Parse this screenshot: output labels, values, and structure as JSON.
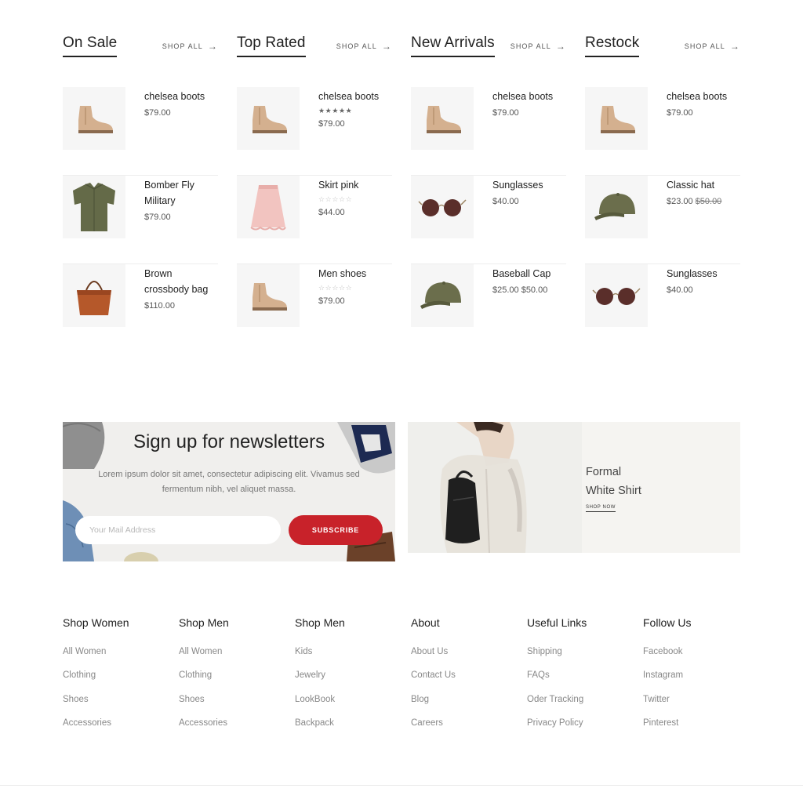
{
  "columns": [
    {
      "title": "On Sale",
      "shop_all": "SHOP ALL",
      "arrow": "→",
      "items": [
        {
          "name": "chelsea boots",
          "price": "$79.00",
          "icon": "boot-icon"
        },
        {
          "name": "Bomber Fly Military",
          "price": "$79.00",
          "icon": "shirt-icon"
        },
        {
          "name": "Brown crossbody bag",
          "price": "$110.00",
          "icon": "bag-icon"
        }
      ]
    },
    {
      "title": "Top Rated",
      "shop_all": "SHOP ALL",
      "arrow": "→",
      "items": [
        {
          "name": "chelsea boots",
          "stars": "★★★★★",
          "rating": 5,
          "price": "$79.00",
          "icon": "boot-icon"
        },
        {
          "name": "Skirt pink",
          "stars": "☆☆☆☆☆",
          "rating": 0,
          "price": "$44.00",
          "icon": "skirt-icon"
        },
        {
          "name": "Men shoes",
          "stars": "☆☆☆☆☆",
          "rating": 0,
          "price": "$79.00",
          "icon": "boot-icon"
        }
      ]
    },
    {
      "title": "New Arrivals",
      "shop_all": "SHOP ALL",
      "arrow": "→",
      "items": [
        {
          "name": "chelsea boots",
          "price": "$79.00",
          "icon": "boot-icon"
        },
        {
          "name": "Sunglasses",
          "price": "$40.00",
          "icon": "sunglasses-icon"
        },
        {
          "name": "Baseball Cap",
          "price": "$25.00 $50.00",
          "icon": "cap-icon"
        }
      ]
    },
    {
      "title": "Restock",
      "shop_all": "SHOP ALL",
      "arrow": "→",
      "items": [
        {
          "name": "chelsea boots",
          "price": "$79.00",
          "icon": "boot-icon"
        },
        {
          "name": "Classic hat",
          "price": "$23.00",
          "old_price": "$50.00",
          "icon": "cap-icon"
        },
        {
          "name": "Sunglasses",
          "price": "$40.00",
          "icon": "sunglasses-icon"
        }
      ]
    }
  ],
  "newsletter": {
    "title": "Sign up for newsletters",
    "text": "Lorem ipsum dolor sit amet, consectetur adipiscing elit. Vivamus sed fermentum nibh, vel aliquet massa.",
    "placeholder": "Your Mail Address",
    "button": "SUBSCRIBE"
  },
  "promo": {
    "line1": "Formal",
    "line2": "White Shirt",
    "link": "SHOP NOW"
  },
  "footer": [
    {
      "title": "Shop Women",
      "links": [
        "All Women",
        "Clothing",
        "Shoes",
        "Accessories"
      ]
    },
    {
      "title": "Shop Men",
      "links": [
        "All Women",
        "Clothing",
        "Shoes",
        "Accessories"
      ]
    },
    {
      "title": "Shop Men",
      "links": [
        "Kids",
        "Jewelry",
        "LookBook",
        "Backpack"
      ]
    },
    {
      "title": "About",
      "links": [
        "About Us",
        "Contact Us",
        "Blog",
        "Careers"
      ]
    },
    {
      "title": "Useful Links",
      "links": [
        "Shipping",
        "FAQs",
        "Oder Tracking",
        "Privacy Policy"
      ]
    },
    {
      "title": "Follow Us",
      "links": [
        "Facebook",
        "Instagram",
        "Twitter",
        "Pinterest"
      ]
    }
  ],
  "colors": {
    "accent": "#c8222a",
    "text": "#222222",
    "muted": "#888888",
    "thumb_bg": "#f6f6f6"
  }
}
